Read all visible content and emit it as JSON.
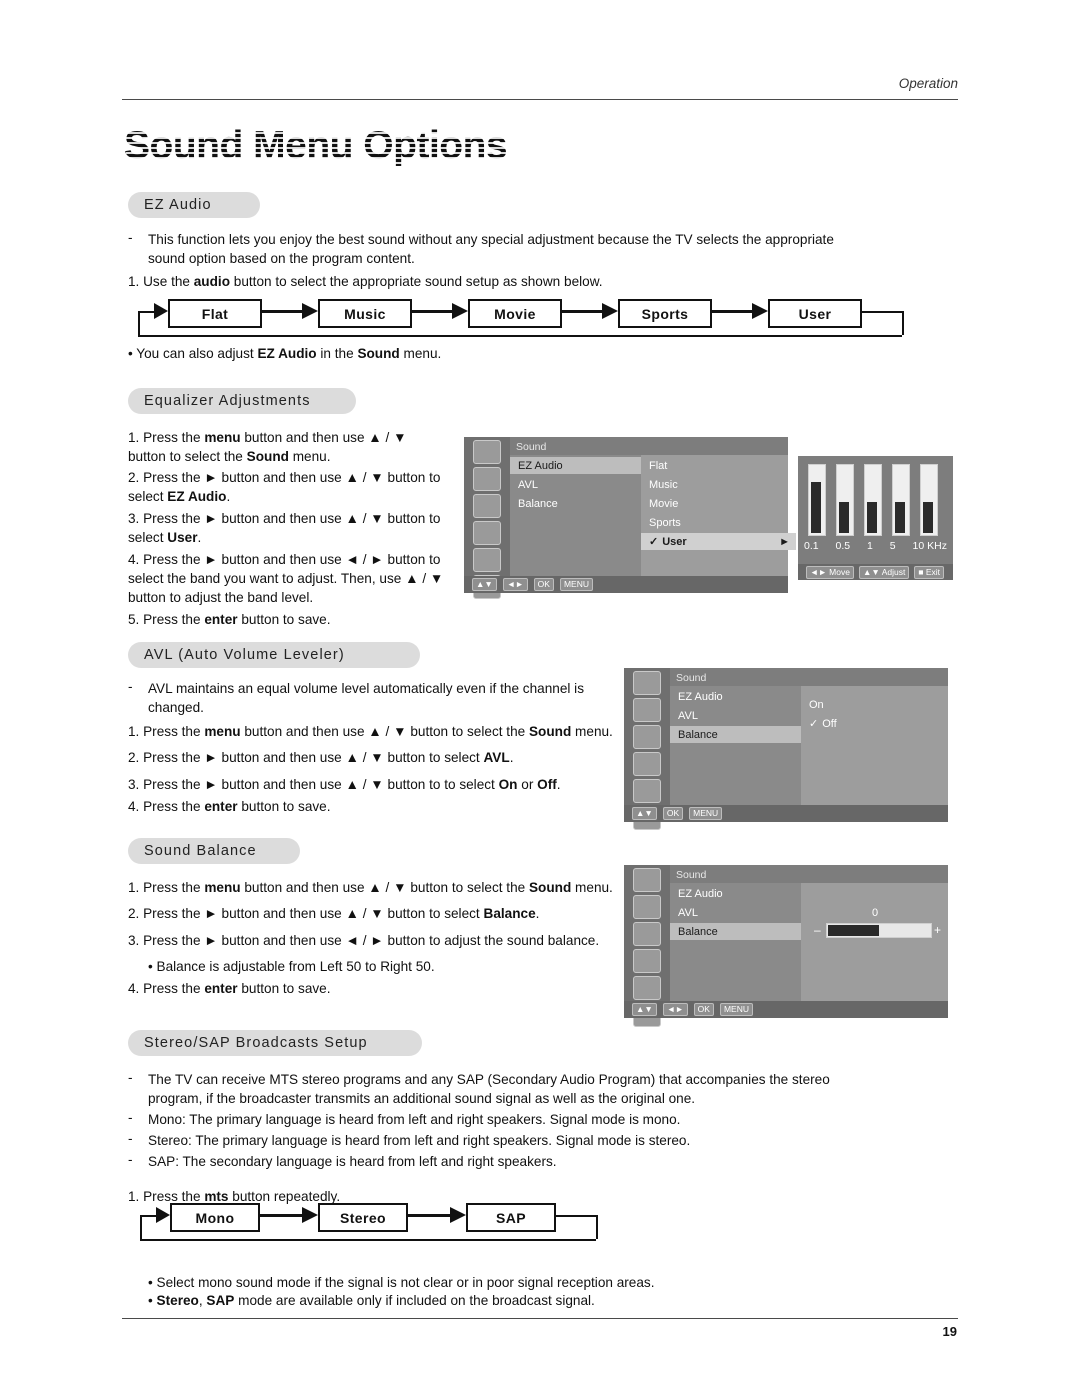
{
  "header": {
    "section": "Operation",
    "page_number": "19"
  },
  "title": "Sound Menu Options",
  "sections": {
    "ez_audio": {
      "heading": "EZ Audio",
      "desc_dash": "-",
      "desc": "This function lets you enjoy the best sound without any special adjustment because the TV selects the appropriate sound option based on the program content.",
      "step1": "1. Use the <b>audio</b> button to select the appropriate sound setup as shown below.",
      "flow": [
        "Flat",
        "Music",
        "Movie",
        "Sports",
        "User"
      ],
      "note": "• You can also adjust <b>EZ Audio</b> in the <b>Sound</b> menu."
    },
    "equalizer": {
      "heading": "Equalizer Adjustments",
      "steps": [
        "1. Press the <b>menu</b> button and then use ▲ / ▼ button to select the <b>Sound</b> menu.",
        "2. Press the ► button and then use ▲ / ▼ button to select <b>EZ Audio</b>.",
        "3. Press the ► button and then use ▲ / ▼ button to select <b>User</b>.",
        "4. Press the ► button and then use ◄ / ► button to select the band you want to adjust. Then, use ▲ / ▼ button to adjust the band level.",
        "5. Press the <b>enter</b> button to save."
      ],
      "osd": {
        "title": "Sound",
        "menu_items": [
          "EZ Audio",
          "AVL",
          "Balance"
        ],
        "selected_item": "EZ Audio",
        "options": [
          "Flat",
          "Music",
          "Movie",
          "Sports",
          "User"
        ],
        "checked_option": "User",
        "check_glyph": "✓",
        "arrow_glyph": "►",
        "bottom_keys": [
          "▲▼",
          "◄►",
          "OK",
          "MENU"
        ]
      },
      "eq": {
        "band_labels": [
          "0.1",
          "0.5",
          "1",
          "5",
          "10 KHz"
        ],
        "band_levels": [
          78,
          50,
          50,
          50,
          50
        ],
        "footer": [
          "◄► Move",
          "▲▼ Adjust",
          "■ Exit"
        ]
      }
    },
    "avl": {
      "heading": "AVL (Auto Volume Leveler)",
      "desc_dash": "-",
      "desc": "AVL maintains an equal volume level automatically even if the channel is changed.",
      "steps": [
        "1. Press the <b>menu</b> button and then use ▲ / ▼ button to select the <b>Sound</b> menu.",
        "2. Press the ► button and then use ▲ / ▼ button to select <b>AVL</b>.",
        "3. Press the ► button and then use ▲ / ▼ button to to select <b>On</b> or <b>Off</b>.",
        "4. Press the <b>enter</b> button to save."
      ],
      "osd": {
        "title": "Sound",
        "menu_items": [
          "EZ Audio",
          "AVL",
          "Balance"
        ],
        "selected_item": "AVL",
        "options": [
          "On",
          "Off"
        ],
        "checked_option": "Off",
        "check_glyph": "✓",
        "bottom_keys": [
          "▲▼",
          "OK",
          "MENU"
        ]
      }
    },
    "balance": {
      "heading": "Sound Balance",
      "steps": [
        "1. Press the <b>menu</b> button and then use ▲ / ▼ button to select the <b>Sound</b> menu.",
        "2. Press the ► button and then use ▲ / ▼ button to select <b>Balance</b>.",
        "3. Press the ► button and then use ◄ / ► button to adjust the sound balance."
      ],
      "note": "• Balance is adjustable from Left 50 to Right 50.",
      "step4": "4. Press the <b>enter</b> button to save.",
      "osd": {
        "title": "Sound",
        "menu_items": [
          "EZ Audio",
          "AVL",
          "Balance"
        ],
        "selected_item": "Balance",
        "value": "0",
        "minus": "–",
        "plus": "+",
        "slider_percent": 50,
        "bottom_keys": [
          "▲▼",
          "◄►",
          "OK",
          "MENU"
        ]
      }
    },
    "stereo_sap": {
      "heading": "Stereo/SAP Broadcasts Setup",
      "lines": [
        "The TV can receive MTS stereo programs and any SAP (Secondary Audio Program) that accompanies the stereo program, if the broadcaster transmits an additional sound signal as well as the original one.",
        "Mono: The primary language is heard from left and right speakers. Signal mode is mono.",
        "Stereo: The primary language is heard from left and right speakers. Signal mode is stereo.",
        "SAP: The secondary language is heard from left and right speakers."
      ],
      "step1": "1. Press the <b>mts</b> button repeatedly.",
      "flow": [
        "Mono",
        "Stereo",
        "SAP"
      ],
      "note1": "• Select mono sound mode if the signal is not clear or in poor signal reception areas.",
      "note2": "• <b>Stereo</b>, <b>SAP</b> mode are available only if included on the broadcast signal."
    }
  }
}
